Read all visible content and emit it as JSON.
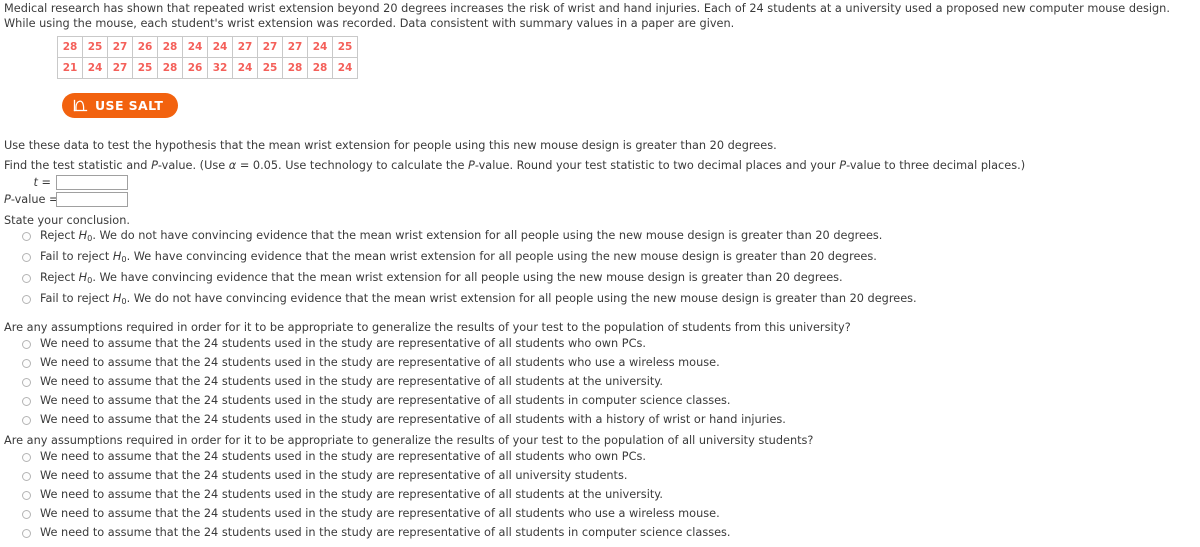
{
  "intro": {
    "paragraph": "Medical research has shown that repeated wrist extension beyond 20 degrees increases the risk of wrist and hand injuries. Each of 24 students at a university used a proposed new computer mouse design. While using the mouse, each student's wrist extension was recorded. Data consistent with summary values in a paper are given."
  },
  "data_table": {
    "rows": [
      [
        "28",
        "25",
        "27",
        "26",
        "28",
        "24",
        "24",
        "27",
        "27",
        "27",
        "24",
        "25"
      ],
      [
        "21",
        "24",
        "27",
        "25",
        "28",
        "26",
        "32",
        "24",
        "25",
        "28",
        "28",
        "24"
      ]
    ],
    "text_color": "#f4605a",
    "border_color": "#c9c9c9"
  },
  "salt_button": {
    "label": "USE SALT",
    "icon": "distribution-curve-icon",
    "background_color": "#f2620f",
    "text_color": "#ffffff"
  },
  "questions": {
    "hypothesis_line": "Use these data to test the hypothesis that the mean wrist extension for people using this new mouse design is greater than 20 degrees.",
    "find_line_part1": "Find the test statistic and ",
    "find_line_pvalue": "P",
    "find_line_part2": "-value. (Use ",
    "find_line_alpha": "α",
    "find_line_part3": " = 0.05. Use technology to calculate the ",
    "find_line_pvalue2": "P",
    "find_line_part4": "-value. Round your test statistic to two decimal places and your ",
    "find_line_pvalue3": "P",
    "find_line_part5": "-value to three decimal places.)",
    "state_conclusion": "State your conclusion.",
    "assumptions_q1": "Are any assumptions required in order for it to be appropriate to generalize the results of your test to the population of students from this university?",
    "assumptions_q2": "Are any assumptions required in order for it to be appropriate to generalize the results of your test to the population of all university students?"
  },
  "answer_fields": {
    "t_label_symbol": "t",
    "t_label_equals": " = ",
    "t_value": "",
    "t_placeholder": "",
    "p_label_symbol": "P",
    "p_label_rest": "-value  =  ",
    "p_value": "",
    "p_placeholder": ""
  },
  "conclusion_options": [
    {
      "decision": "Reject ",
      "h_symbol": "H",
      "h_sub": "0",
      "rest": ". We do not have convincing evidence that the mean wrist extension for all people using the new mouse design is greater than 20 degrees.",
      "selected": false
    },
    {
      "decision": "Fail to reject ",
      "h_symbol": "H",
      "h_sub": "0",
      "rest": ". We have convincing evidence that the mean wrist extension for all people using the new mouse design is greater than 20 degrees.",
      "selected": false
    },
    {
      "decision": "Reject ",
      "h_symbol": "H",
      "h_sub": "0",
      "rest": ". We have convincing evidence that the mean wrist extension for all people using the new mouse design is greater than 20 degrees.",
      "selected": false
    },
    {
      "decision": "Fail to reject ",
      "h_symbol": "H",
      "h_sub": "0",
      "rest": ". We do not have convincing evidence that the mean wrist extension for all people using the new mouse design is greater than 20 degrees.",
      "selected": false
    }
  ],
  "assumption_options_1": [
    {
      "label": "We need to assume that the 24 students used in the study are representative of all students who own PCs.",
      "selected": false
    },
    {
      "label": "We need to assume that the 24 students used in the study are representative of all students who use a wireless mouse.",
      "selected": false
    },
    {
      "label": "We need to assume that the 24 students used in the study are representative of all students at the university.",
      "selected": false
    },
    {
      "label": "We need to assume that the 24 students used in the study are representative of all students in computer science classes.",
      "selected": false
    },
    {
      "label": "We need to assume that the 24 students used in the study are representative of all students with a history of wrist or hand injuries.",
      "selected": false
    }
  ],
  "assumption_options_2": [
    {
      "label": "We need to assume that the 24 students used in the study are representative of all students who own PCs.",
      "selected": false
    },
    {
      "label": "We need to assume that the 24 students used in the study are representative of all university students.",
      "selected": false
    },
    {
      "label": "We need to assume that the 24 students used in the study are representative of all students at the university.",
      "selected": false
    },
    {
      "label": "We need to assume that the 24 students used in the study are representative of all students who use a wireless mouse.",
      "selected": false
    },
    {
      "label": "We need to assume that the 24 students used in the study are representative of all students in computer science classes.",
      "selected": false
    }
  ]
}
